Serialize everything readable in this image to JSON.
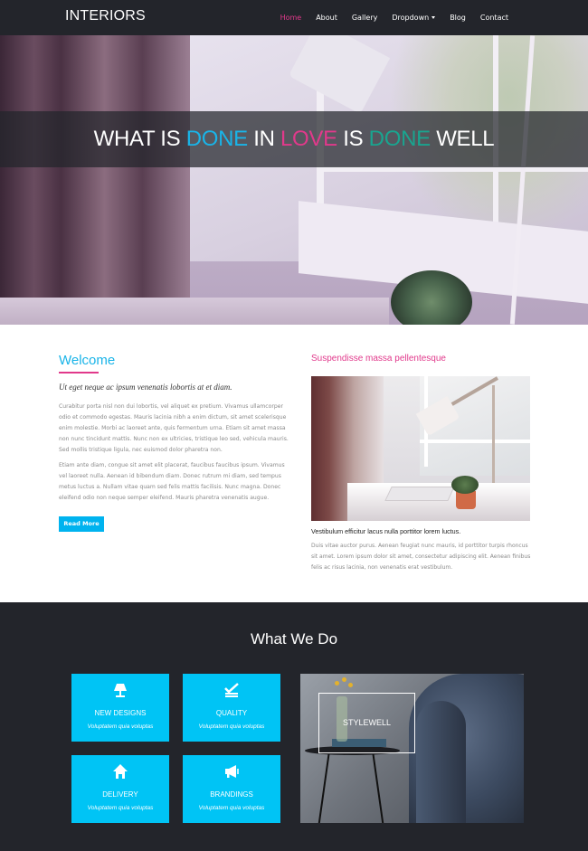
{
  "nav": {
    "brand": "INTERIORS",
    "items": [
      {
        "label": "Home"
      },
      {
        "label": "About"
      },
      {
        "label": "Gallery"
      },
      {
        "label": "Dropdown"
      },
      {
        "label": "Blog"
      },
      {
        "label": "Contact"
      }
    ],
    "active": "Home"
  },
  "hero": {
    "words": [
      "WHAT IS",
      "DONE",
      "IN",
      "LOVE",
      "IS",
      "DONE",
      "WELL"
    ]
  },
  "welcome": {
    "title": "Welcome",
    "lead": "Ut eget neque ac ipsum venenatis lobortis at et diam.",
    "para1": "Curabitur porta nisl non dui lobortis, vel aliquet ex pretium. Vivamus ullamcorper odio et commodo egestas. Mauris lacinia nibh a enim dictum, sit amet scelerisque enim molestie. Morbi ac laoreet ante, quis fermentum urna. Etiam sit amet massa non nunc tincidunt mattis. Nunc non ex ultricies, tristique leo sed, vehicula mauris. Sed mollis tristique ligula, nec euismod dolor pharetra non.",
    "para2": "Etiam ante diam, congue sit amet elit placerat, faucibus faucibus ipsum. Vivamus vel laoreet nulla. Aenean id bibendum diam. Donec rutrum mi diam, sed tempus metus luctus a. Nullam vitae quam sed felis mattis facilisis. Nunc magna. Donec eleifend odio non neque semper eleifend. Mauris pharetra venenatis augue.",
    "button": "Read More"
  },
  "side": {
    "title": "Suspendisse massa pellentesque",
    "caption": "Vestibulum efficitur lacus nulla porttitor lorem luctus.",
    "para": "Duis vitae auctor purus. Aenean feugiat nunc mauris, id porttitor turpis rhoncus sit amet. Lorem ipsum dolor sit amet, consectetur adipiscing elit. Aenean finibus felis ac risus lacinia, non venenatis erat vestibulum."
  },
  "services": {
    "title": "What We Do",
    "cards": [
      {
        "label": "NEW DESIGNS",
        "sub": "Voluptatem quia voluptas",
        "icon": "lamp-icon"
      },
      {
        "label": "QUALITY",
        "sub": "Voluptatem quia voluptas",
        "icon": "check-icon"
      },
      {
        "label": "DELIVERY",
        "sub": "Voluptatem quia voluptas",
        "icon": "home-icon"
      },
      {
        "label": "BRANDINGS",
        "sub": "Voluptatem quia voluptas",
        "icon": "megaphone-icon"
      }
    ],
    "promo": "STYLEWELL"
  },
  "colors": {
    "accent_blue": "#19b4e8",
    "accent_pink": "#e1398b",
    "accent_teal": "#1aa48f",
    "dark": "#23252b",
    "card": "#00c4f5"
  }
}
